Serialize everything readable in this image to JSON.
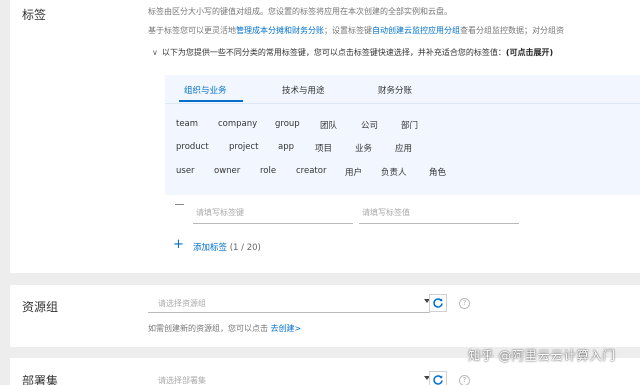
{
  "tags_section": {
    "label": "标签",
    "desc1": "标签由区分大小写的键值对组成。您设置的标签将应用在本次创建的全部实例和云盘。",
    "desc2_a": "基于标签您可以更灵活地",
    "desc2_link1": "管理成本分摊和财务分账",
    "desc2_b": "；设置标签键",
    "desc2_link2": "自动创建云监控应用分组",
    "desc2_c": "查看分组监控数据；对分组资",
    "hint_text": "以下为您提供一些不同分类的常用标签键，您可以点击标签键快速选择，并补充适合您的标签值：",
    "hint_bold": "(可点击展开)",
    "tabs": [
      "组织与业务",
      "技术与用途",
      "财务分账"
    ],
    "chips_row1": [
      "team",
      "company",
      "group",
      "团队",
      "公司",
      "部门"
    ],
    "chips_row2": [
      "product",
      "project",
      "app",
      "项目",
      "业务",
      "应用"
    ],
    "chips_row3": [
      "user",
      "owner",
      "role",
      "creator",
      "用户",
      "负责人",
      "角色"
    ],
    "key_placeholder": "请填写标签键",
    "value_placeholder": "请填写标签值",
    "add_label": "添加标签",
    "add_count": "(1 / 20)"
  },
  "resource_group": {
    "label": "资源组",
    "placeholder": "请选择资源组",
    "note": "如需创建新的资源组，您可以点击",
    "note_link": "去创建>"
  },
  "deployment_set": {
    "label": "部署集",
    "placeholder": "请选择部署集"
  },
  "watermark": "知乎 @阿里云云计算入门",
  "icons": {
    "caret": "chevron-down-icon",
    "refresh": "refresh-icon",
    "help": "help-icon",
    "add": "plus-icon",
    "remove": "minus-icon"
  },
  "colors": {
    "accent": "#0070cc",
    "panel_bg": "#f2f7ff",
    "page_bg": "#ededed"
  }
}
